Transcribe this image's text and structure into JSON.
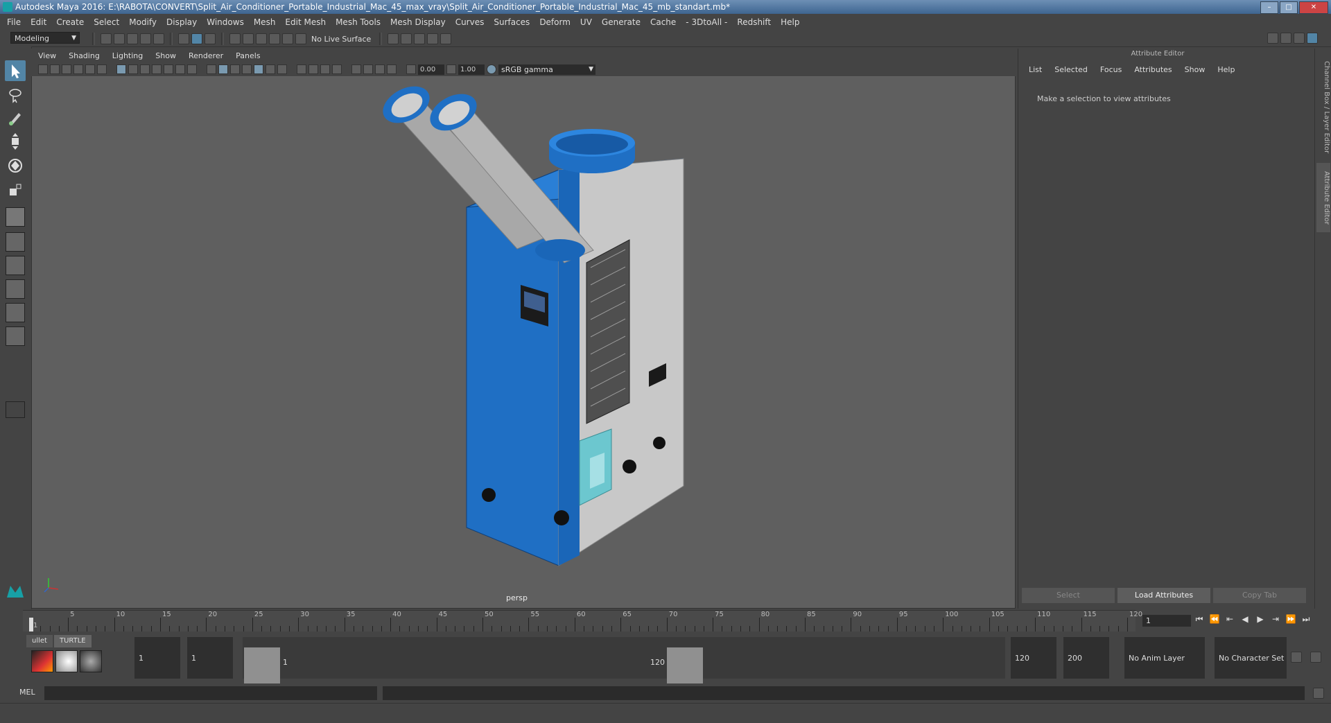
{
  "window": {
    "title": "Autodesk Maya 2016: E:\\RABOTA\\CONVERT\\Split_Air_Conditioner_Portable_Industrial_Mac_45_max_vray\\Split_Air_Conditioner_Portable_Industrial_Mac_45_mb_standart.mb*"
  },
  "menu": [
    "File",
    "Edit",
    "Create",
    "Select",
    "Modify",
    "Display",
    "Windows",
    "Mesh",
    "Edit Mesh",
    "Mesh Tools",
    "Mesh Display",
    "Curves",
    "Surfaces",
    "Deform",
    "UV",
    "Generate",
    "Cache",
    "- 3DtoAll -",
    "Redshift",
    "Help"
  ],
  "status_line": {
    "mode": "Modeling",
    "live_surface": "No Live Surface"
  },
  "panel": {
    "menu": [
      "View",
      "Shading",
      "Lighting",
      "Show",
      "Renderer",
      "Panels"
    ],
    "exposure": "0.00",
    "gamma": "1.00",
    "color_space": "sRGB gamma",
    "camera_label": "persp"
  },
  "attribute_editor": {
    "title": "Attribute Editor",
    "menu": [
      "List",
      "Selected",
      "Focus",
      "Attributes",
      "Show",
      "Help"
    ],
    "message": "Make a selection to view attributes",
    "buttons": {
      "select": "Select",
      "load": "Load Attributes",
      "copy": "Copy Tab"
    }
  },
  "side_tabs": {
    "channel_box": "Channel Box / Layer Editor",
    "attribute_editor": "Attribute Editor"
  },
  "time_slider": {
    "ticks": [
      "1",
      "5",
      "10",
      "15",
      "20",
      "25",
      "30",
      "35",
      "40",
      "45",
      "50",
      "55",
      "60",
      "65",
      "70",
      "75",
      "80",
      "85",
      "90",
      "95",
      "100",
      "105",
      "110",
      "115",
      "120"
    ],
    "current_frame": "1"
  },
  "range_slider": {
    "shelf_tabs": [
      "ullet",
      "TURTLE"
    ],
    "start_time": "1",
    "playback_start": "1",
    "range_start_label": "1",
    "range_end_label": "120",
    "playback_end": "120",
    "end_time": "200",
    "anim_layer": "No Anim Layer",
    "character_set": "No Character Set"
  },
  "command_line": {
    "label": "MEL"
  },
  "colors": {
    "accent": "#5285a6",
    "unit_blue": "#1f6fc4",
    "panel_gray": "#c8c8c8",
    "viewport": "#5f5f5f"
  }
}
